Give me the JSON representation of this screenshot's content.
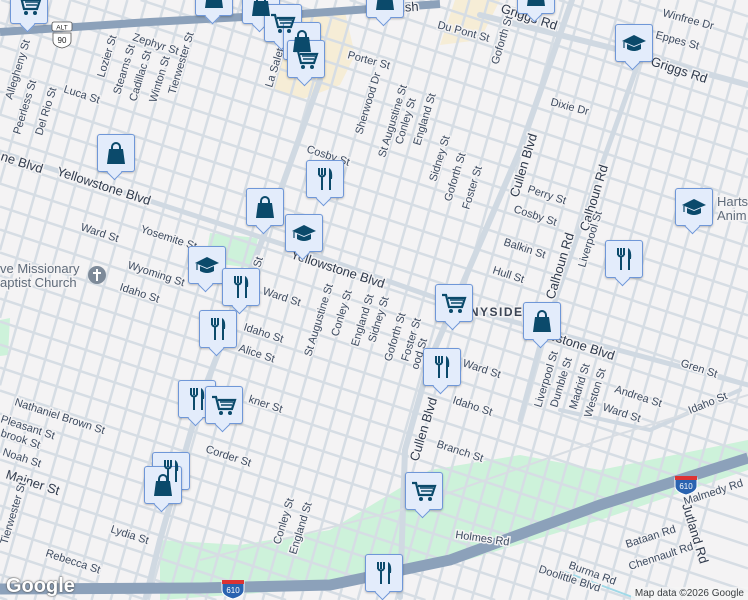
{
  "map": {
    "attribution": "Map data ©2026 Google",
    "logo": "Google",
    "colors": {
      "background": "#f4f3f4",
      "road": "#d5dde5",
      "highway": "#8ca1ba",
      "park": "#cdf2da",
      "commercial": "#f6edd6",
      "marker_fill": "#e3ecfb",
      "marker_border": "#6f97d8",
      "icon": "#0b4a6b"
    },
    "shields": [
      "ALT",
      "90",
      "610",
      "610"
    ],
    "poi": {
      "church_line1": "ve Missionary",
      "church_line2": "aptist Church",
      "harts_line1": "Harts",
      "harts_line2": "Anim"
    },
    "neighborhood": "SUNNYSIDE",
    "street_labels": [
      "Spanish",
      "Griggs Rd",
      "Griggs Rd",
      "Winfree Dr",
      "Eppes St",
      "Du Pont St",
      "Goforth St",
      "Porter St",
      "Dixie Dr",
      "Zephyr St",
      "Allegheny St",
      "Peerless St",
      "Del Rio St",
      "Lozier St",
      "Stearns St",
      "Cadillac St",
      "Winton St",
      "Tierwester St",
      "La Salette",
      "Luca St",
      "Sherwood Dr",
      "St Augustine St",
      "Conley St",
      "England St",
      "Sidney St",
      "Goforth St",
      "Foster St",
      "Cullen Blvd",
      "Calhoun Rd",
      "Perry St",
      "Cosby St",
      "Balkin St",
      "Hull St",
      "Cosby St",
      "ne Blvd",
      "Yellowstone Blvd",
      "Yellowstone Blvd",
      "Yellowstone Blvd",
      "Ward St",
      "Yosemite St",
      "Wyoming St",
      "Idaho St",
      "Ward St",
      "Idaho St",
      "Alice St",
      "St Augustine St",
      "Conley St",
      "England St",
      "Sidney St",
      "Goforth St",
      "Foster St",
      "ood St",
      "Ward St",
      "Idaho St",
      "Branch St",
      "Cullen Blvd",
      "Liverpool St",
      "Dumble St",
      "Madrid St",
      "Weston St",
      "Liverpool St",
      "Calhoun Rd",
      "Andrea St",
      "Ward St",
      "Gren St",
      "Idaho St",
      "Nathaniel Brown St",
      "Pleasant St",
      "brook St",
      "Noah St",
      "Mainer St",
      "Corder St",
      "kner St",
      "Tierwester St",
      "Lydia St",
      "Rebecca St",
      "Conley St",
      "England St",
      "Holmes Rd",
      "Malmedy Rd",
      "Jutland Rd",
      "Bataan Rd",
      "Chennault Rd",
      "Burma Rd",
      "Doolittle Blvd",
      "St"
    ],
    "markers": [
      {
        "type": "cart",
        "label": "grocery-store"
      },
      {
        "type": "bag",
        "label": "shopping"
      },
      {
        "type": "bag",
        "label": "shopping"
      },
      {
        "type": "cart",
        "label": "grocery-store"
      },
      {
        "type": "bag",
        "label": "shopping"
      },
      {
        "type": "cart",
        "label": "grocery-store"
      },
      {
        "type": "bag",
        "label": "shopping"
      },
      {
        "type": "bag",
        "label": "shopping"
      },
      {
        "type": "school",
        "label": "school"
      },
      {
        "type": "bag",
        "label": "shopping"
      },
      {
        "type": "food",
        "label": "restaurant"
      },
      {
        "type": "bag",
        "label": "shopping"
      },
      {
        "type": "school",
        "label": "school"
      },
      {
        "type": "school",
        "label": "school"
      },
      {
        "type": "food",
        "label": "restaurant"
      },
      {
        "type": "food",
        "label": "restaurant"
      },
      {
        "type": "food",
        "label": "restaurant"
      },
      {
        "type": "cart",
        "label": "grocery-store"
      },
      {
        "type": "cart",
        "label": "grocery-store"
      },
      {
        "type": "bag",
        "label": "shopping"
      },
      {
        "type": "food",
        "label": "restaurant"
      },
      {
        "type": "school",
        "label": "school"
      },
      {
        "type": "food",
        "label": "restaurant"
      },
      {
        "type": "food",
        "label": "restaurant"
      },
      {
        "type": "bag",
        "label": "shopping"
      },
      {
        "type": "cart",
        "label": "grocery-store"
      },
      {
        "type": "food",
        "label": "restaurant"
      }
    ]
  }
}
